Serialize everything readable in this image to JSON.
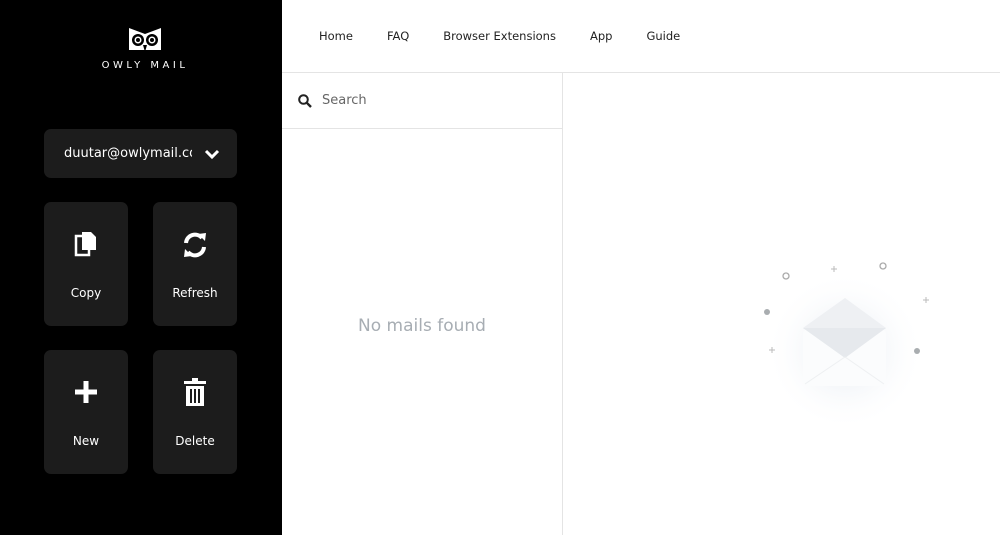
{
  "brand": {
    "name": "OWLY MAIL"
  },
  "account": {
    "email": "duutar@owlymail.com"
  },
  "actions": [
    {
      "label": "Copy",
      "icon": "copy-icon"
    },
    {
      "label": "Refresh",
      "icon": "refresh-icon"
    },
    {
      "label": "New",
      "icon": "plus-icon"
    },
    {
      "label": "Delete",
      "icon": "trash-icon"
    }
  ],
  "nav": [
    "Home",
    "FAQ",
    "Browser Extensions",
    "App",
    "Guide"
  ],
  "search": {
    "placeholder": "Search",
    "value": ""
  },
  "mail_list": {
    "empty_text": "No mails found"
  }
}
